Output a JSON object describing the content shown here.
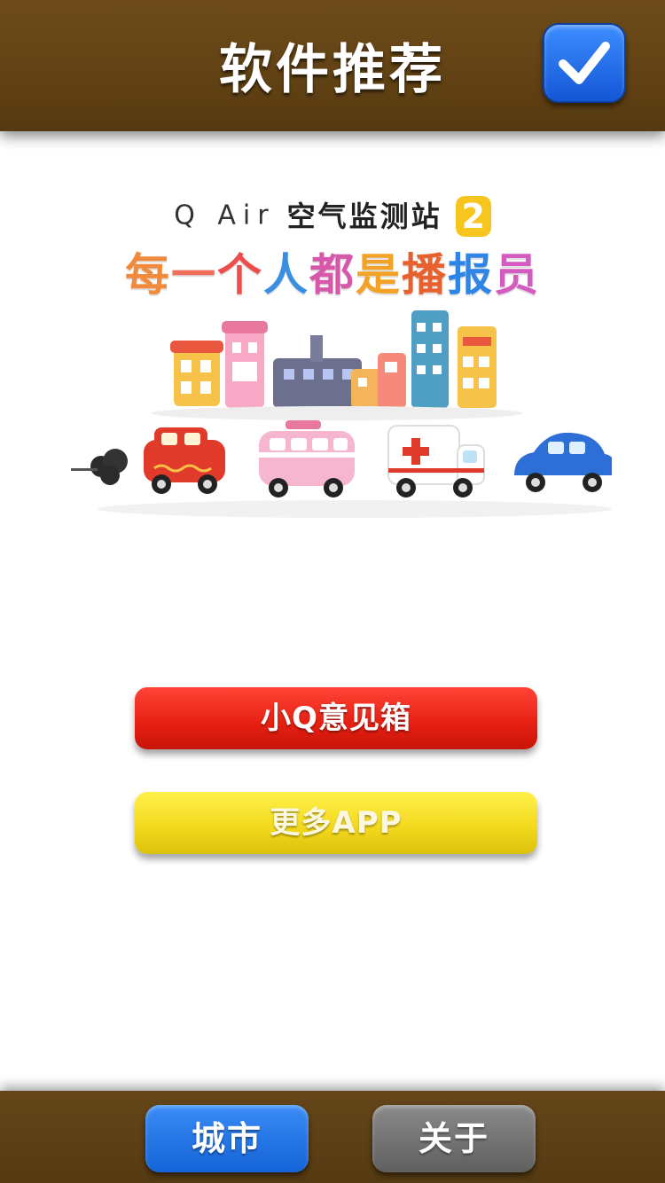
{
  "header": {
    "title": "软件推荐",
    "confirm_icon": "checkmark-icon"
  },
  "banner": {
    "brand": "Q Air",
    "station_name": "空气监测站",
    "version": "2",
    "slogan_chars": [
      "每",
      "一",
      "个",
      "人",
      "都",
      "是",
      "播",
      "报",
      "员"
    ],
    "slogan_colors": [
      "#f08a3c",
      "#ef6f5b",
      "#ef4c4c",
      "#3a8fe3",
      "#d659a9",
      "#f2a327",
      "#e6612d",
      "#2e85e6",
      "#d45bc0"
    ]
  },
  "buttons": {
    "feedback": "小Q意见箱",
    "more_apps": "更多APP"
  },
  "tabbar": {
    "city": "城市",
    "about": "关于"
  },
  "colors": {
    "header_brown": "#5f4013",
    "accent_blue": "#1a6fe6",
    "feedback_red": "#e51f12",
    "more_yellow": "#f2d81c",
    "inactive_gray": "#707070"
  }
}
